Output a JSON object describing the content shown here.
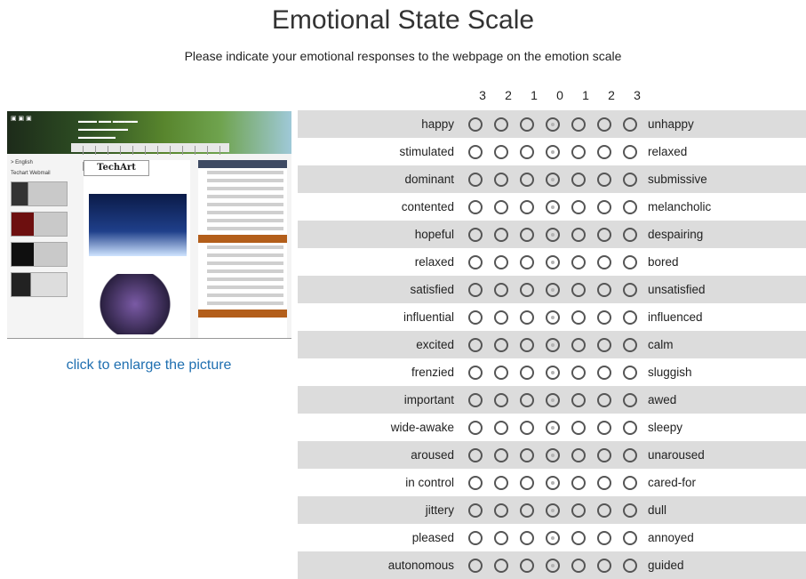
{
  "title": "Emotional State Scale",
  "subtitle": "Please indicate your emotional responses to the webpage on the emotion scale",
  "enlarge_link": "click to enlarge the picture",
  "preview": {
    "english_link": "> English",
    "webmail_link": "Techart Webmail",
    "techart_logo": "TechArt"
  },
  "scale_numbers": [
    "3",
    "2",
    "1",
    "0",
    "1",
    "2",
    "3"
  ],
  "rows": [
    {
      "left": "happy",
      "right": "unhappy"
    },
    {
      "left": "stimulated",
      "right": "relaxed"
    },
    {
      "left": "dominant",
      "right": "submissive"
    },
    {
      "left": "contented",
      "right": "melancholic"
    },
    {
      "left": "hopeful",
      "right": "despairing"
    },
    {
      "left": "relaxed",
      "right": "bored"
    },
    {
      "left": "satisfied",
      "right": "unsatisfied"
    },
    {
      "left": "influential",
      "right": "influenced"
    },
    {
      "left": "excited",
      "right": "calm"
    },
    {
      "left": "frenzied",
      "right": "sluggish"
    },
    {
      "left": "important",
      "right": "awed"
    },
    {
      "left": "wide-awake",
      "right": "sleepy"
    },
    {
      "left": "aroused",
      "right": "unaroused"
    },
    {
      "left": "in control",
      "right": "cared-for"
    },
    {
      "left": "jittery",
      "right": "dull"
    },
    {
      "left": "pleased",
      "right": "annoyed"
    },
    {
      "left": "autonomous",
      "right": "guided"
    }
  ]
}
